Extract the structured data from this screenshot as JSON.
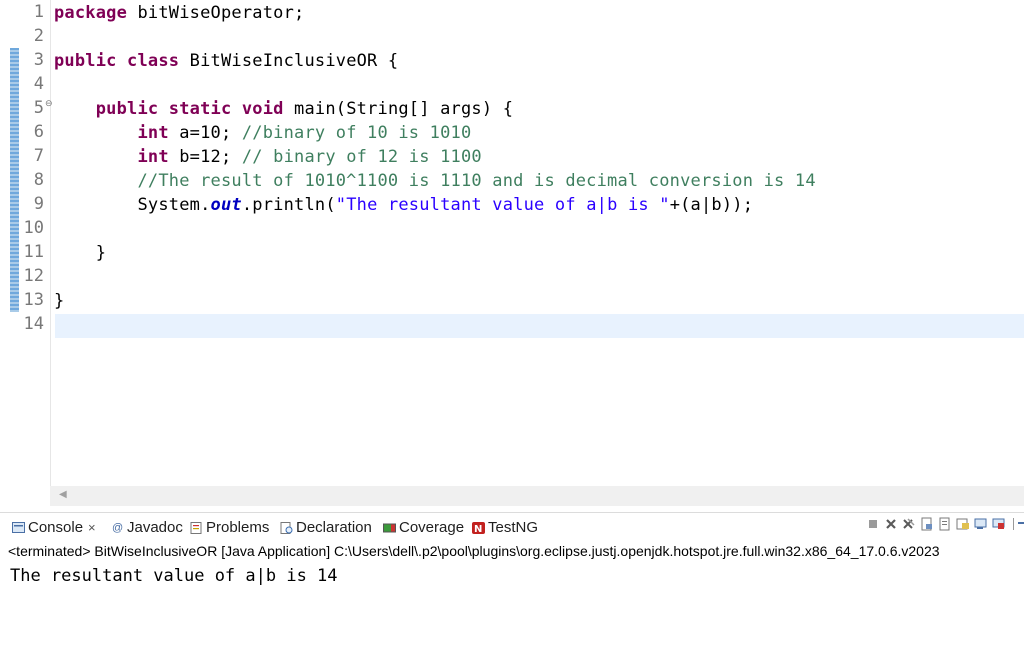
{
  "editor": {
    "lines": [
      {
        "num": "1",
        "tokens": [
          {
            "t": "package",
            "c": "kw"
          },
          {
            "t": " bitWiseOperator;",
            "c": ""
          }
        ]
      },
      {
        "num": "2",
        "tokens": []
      },
      {
        "num": "3",
        "tokens": [
          {
            "t": "public",
            "c": "kw"
          },
          {
            "t": " ",
            "c": ""
          },
          {
            "t": "class",
            "c": "kw"
          },
          {
            "t": " BitWiseInclusiveOR {",
            "c": ""
          }
        ]
      },
      {
        "num": "4",
        "tokens": []
      },
      {
        "num": "5",
        "fold": "⊖",
        "tokens": [
          {
            "t": "    ",
            "c": ""
          },
          {
            "t": "public",
            "c": "kw"
          },
          {
            "t": " ",
            "c": ""
          },
          {
            "t": "static",
            "c": "kw"
          },
          {
            "t": " ",
            "c": ""
          },
          {
            "t": "void",
            "c": "kw"
          },
          {
            "t": " main(String[] args) {",
            "c": ""
          }
        ]
      },
      {
        "num": "6",
        "tokens": [
          {
            "t": "        ",
            "c": ""
          },
          {
            "t": "int",
            "c": "kw"
          },
          {
            "t": " a=10; ",
            "c": ""
          },
          {
            "t": "//binary of 10 is 1010",
            "c": "cm"
          }
        ]
      },
      {
        "num": "7",
        "tokens": [
          {
            "t": "        ",
            "c": ""
          },
          {
            "t": "int",
            "c": "kw"
          },
          {
            "t": " b=12; ",
            "c": ""
          },
          {
            "t": "// binary of 12 is 1100",
            "c": "cm"
          }
        ]
      },
      {
        "num": "8",
        "tokens": [
          {
            "t": "        ",
            "c": ""
          },
          {
            "t": "//The result of 1010^1100 is 1110 and is decimal conversion is 14",
            "c": "cm"
          }
        ]
      },
      {
        "num": "9",
        "tokens": [
          {
            "t": "        System.",
            "c": ""
          },
          {
            "t": "out",
            "c": "fld"
          },
          {
            "t": ".println(",
            "c": ""
          },
          {
            "t": "\"The resultant value of a|b is \"",
            "c": "str"
          },
          {
            "t": "+(a|b));",
            "c": ""
          }
        ]
      },
      {
        "num": "10",
        "tokens": []
      },
      {
        "num": "11",
        "tokens": [
          {
            "t": "    }",
            "c": ""
          }
        ]
      },
      {
        "num": "12",
        "tokens": []
      },
      {
        "num": "13",
        "tokens": [
          {
            "t": "}",
            "c": ""
          }
        ]
      },
      {
        "num": "14",
        "tokens": [],
        "current": true
      }
    ]
  },
  "views": {
    "tabs": [
      {
        "label": "Console",
        "icon": "console-icon",
        "active": true,
        "close": "×"
      },
      {
        "label": "Javadoc",
        "icon": "javadoc-icon"
      },
      {
        "label": "Problems",
        "icon": "problems-icon"
      },
      {
        "label": "Declaration",
        "icon": "declaration-icon"
      },
      {
        "label": "Coverage",
        "icon": "coverage-icon"
      },
      {
        "label": "TestNG",
        "icon": "testng-icon"
      }
    ]
  },
  "console": {
    "header": "<terminated> BitWiseInclusiveOR [Java Application] C:\\Users\\dell\\.p2\\pool\\plugins\\org.eclipse.justj.openjdk.hotspot.jre.full.win32.x86_64_17.0.6.v2023",
    "output": "The resultant value of a|b is 14"
  },
  "colors": {
    "keyword": "#7f0055",
    "comment": "#3f7f5f",
    "string": "#2a00ff",
    "field": "#0000c0",
    "current_line": "#e8f2fe"
  }
}
